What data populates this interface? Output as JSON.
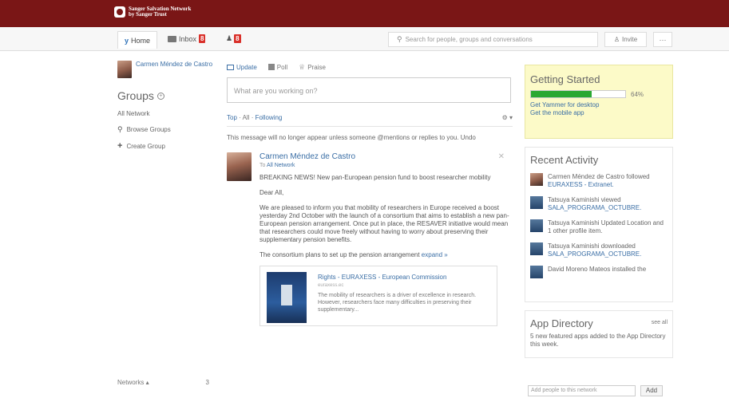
{
  "brand": {
    "name_line1": "Sanger Salvation Network",
    "name_line2": "by Sanger Trust"
  },
  "nav": {
    "home_label": "Home",
    "inbox_label": "Inbox",
    "inbox_count": "8",
    "notif_count": "8",
    "search_placeholder": "Search for people, groups and conversations",
    "invite_label": "Invite",
    "more_label": "···"
  },
  "sidebar": {
    "user_name": "Carmen Méndez de Castro",
    "groups_title": "Groups",
    "all_network": "All Network",
    "browse_groups": "Browse Groups",
    "create_group": "Create Group",
    "networks_label": "Networks",
    "networks_badge": "3"
  },
  "publisher": {
    "tabs": [
      {
        "label": "Update"
      },
      {
        "label": "Poll"
      },
      {
        "label": "Praise"
      }
    ],
    "placeholder": "What are you working on?"
  },
  "feed": {
    "filters": [
      "Top",
      "All",
      "Following"
    ],
    "notice": "This message will no longer appear unless someone @mentions or replies to you. Undo"
  },
  "post": {
    "author": "Carmen Méndez de Castro",
    "to_prefix": "To",
    "to_target": "All Network",
    "headline": "BREAKING NEWS! New pan-European pension fund to boost researcher mobility",
    "greeting": "Dear All,",
    "body": "We are pleased to inform you that mobility of researchers in Europe received a boost yesterday 2nd October with the launch of a consortium that aims to establish a new pan-European pension arrangement. Once put in place, the RESAVER initiative would mean that researchers could move freely without having to worry about preserving their supplementary pension benefits.",
    "more_text": "The consortium plans to set up the pension arrangement",
    "expand_label": "expand »",
    "attachment": {
      "title": "Rights - EURAXESS - European Commission",
      "site": "euraxess.ec",
      "desc": "The mobility of researchers is a driver of excellence in research. However, researchers face many difficulties in preserving their supplementary..."
    }
  },
  "getting_started": {
    "title": "Getting Started",
    "progress": 0.64,
    "progress_text": "64%",
    "link1": "Get Yammer for desktop",
    "link2": "Get the mobile app"
  },
  "recent_activity": {
    "title": "Recent Activity",
    "items": [
      {
        "text": "Carmen Méndez de Castro followed",
        "link": "EURAXESS - Extranet."
      },
      {
        "text": "Tatsuya Kaminishi viewed",
        "link": "SALA_PROGRAMA_OCTUBRE."
      },
      {
        "text": "Tatsuya Kaminishi Updated Location and 1 other profile item.",
        "link": ""
      },
      {
        "text": "Tatsuya Kaminishi downloaded",
        "link": "SALA_PROGRAMA_OCTUBRE."
      },
      {
        "text": "David Moreno Mateos installed the",
        "link": ""
      }
    ]
  },
  "app_directory": {
    "title": "App Directory",
    "see_all": "see all",
    "desc": "5 new featured apps added to the App Directory this week."
  },
  "add_people": {
    "placeholder": "Add people to this network",
    "button": "Add"
  },
  "colors": {
    "brand": "#7a1616",
    "link": "#3a6ea5",
    "badge": "#d9302a",
    "progress": "#2aa833",
    "getting_started_bg": "#fcfac8"
  }
}
